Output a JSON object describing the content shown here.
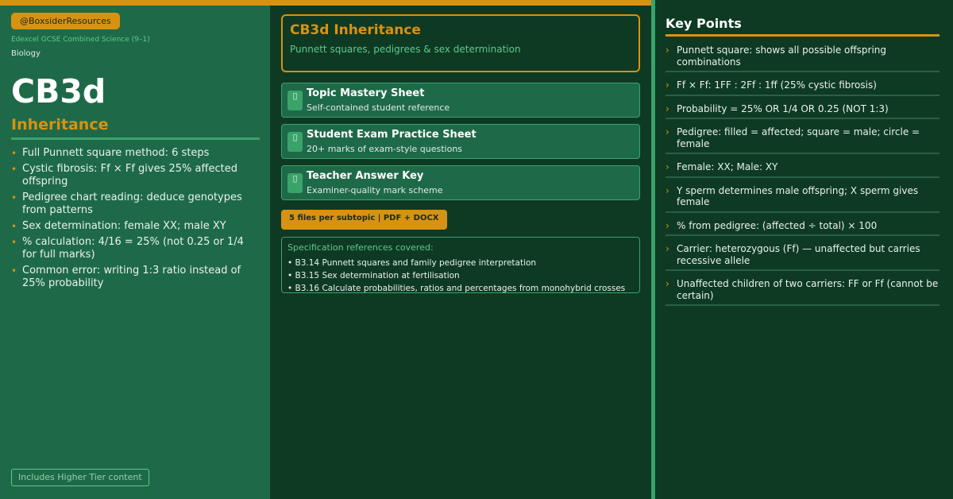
{
  "left": {
    "handle": "@BoxsiderResources",
    "board": "Edexcel GCSE Combined Science (9–1)",
    "subject": "Biology",
    "code": "CB3d",
    "topic": "Inheritance",
    "bullets": [
      "Full Punnett square method: 6 steps",
      "Cystic fibrosis: Ff × Ff gives 25% affected offspring",
      "Pedigree chart reading: deduce genotypes from patterns",
      "Sex determination: female XX; male XY",
      "% calculation: 4/16 = 25% (not 0.25 or 1/4 for full marks)",
      "Common error: writing 1:3 ratio instead of 25% probability"
    ],
    "higher_tier": "Includes Higher Tier content"
  },
  "middle": {
    "title": "CB3d Inheritance",
    "subtitle": "Punnett squares, pedigrees & sex determination",
    "files": [
      {
        "name": "Topic Mastery Sheet",
        "desc": "Self-contained student reference"
      },
      {
        "name": "Student Exam Practice Sheet",
        "desc": "20+ marks of exam-style questions"
      },
      {
        "name": "Teacher Answer Key",
        "desc": "Examiner-quality mark scheme"
      }
    ],
    "files_badge": "5 files per subtopic  |  PDF + DOCX",
    "spec_heading": "Specification references covered:",
    "spec_items": [
      "• B3.14  Punnett squares and family pedigree interpretation",
      "• B3.15  Sex determination at fertilisation",
      "• B3.16  Calculate probabilities, ratios and percentages from monohybrid crosses"
    ]
  },
  "right": {
    "title": "Key Points",
    "points": [
      "Punnett square: shows all possible offspring combinations",
      "Ff × Ff: 1FF : 2Ff : 1ff (25% cystic fibrosis)",
      "Probability = 25% OR 1/4 OR 0.25 (NOT 1:3)",
      "Pedigree: filled = affected; square = male; circle = female",
      "Female: XX; Male: XY",
      "Y sperm determines male offspring; X sperm gives female",
      "% from pedigree: (affected ÷ total) × 100",
      "Carrier: heterozygous (Ff) — unaffected but carries recessive allele",
      "Unaffected children of two carriers: FF or Ff (cannot be certain)"
    ]
  },
  "icons": {
    "file": "document-icon",
    "bullet": "bullet-dot-icon",
    "chevron": "chevron-right-icon"
  },
  "colors": {
    "accent": "#d89212",
    "green_dark": "#0e3a24",
    "green_panel": "#1e6a48",
    "green_light": "#3aa36a"
  }
}
